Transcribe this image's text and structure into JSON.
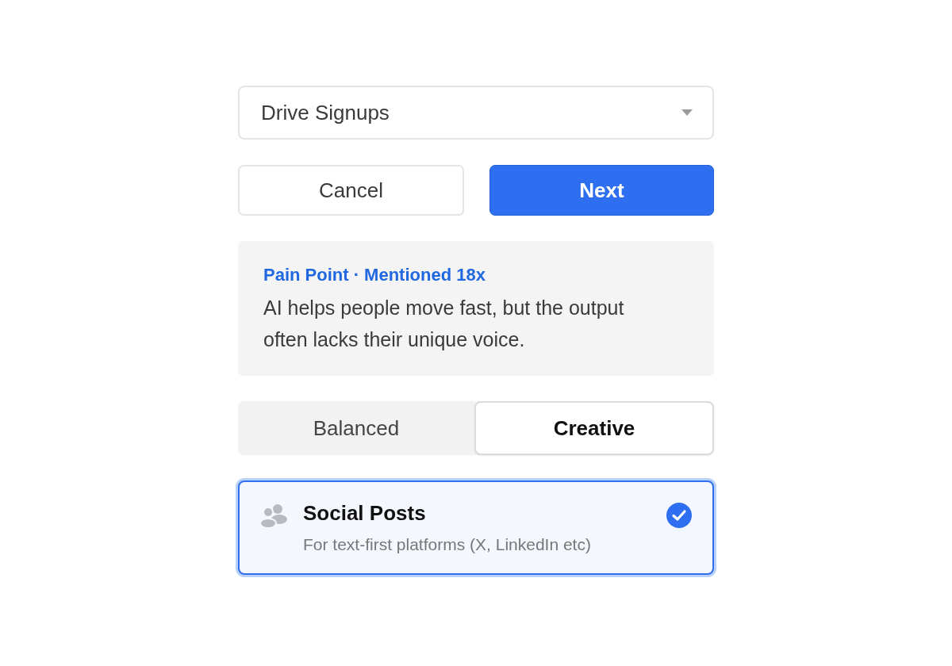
{
  "dropdown": {
    "value": "Drive Signups"
  },
  "buttons": [
    {
      "label": "Cancel",
      "kind": "secondary"
    },
    {
      "label": "Next",
      "kind": "primary"
    }
  ],
  "insight": {
    "tag": "Pain Point · Mentioned 18x",
    "text": "AI helps people move fast, but the output often lacks their unique voice."
  },
  "modes": [
    {
      "label": "Balanced",
      "selected": false
    },
    {
      "label": "Creative",
      "selected": true
    }
  ],
  "options": [
    {
      "title": "Social Posts",
      "description": "For text-first platforms (X, LinkedIn etc)",
      "selected": true
    }
  ]
}
